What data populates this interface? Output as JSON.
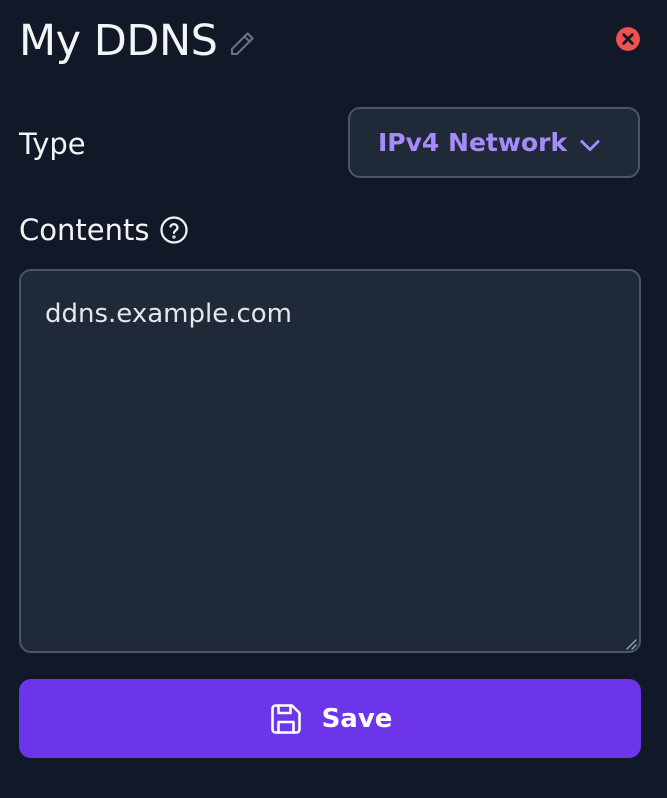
{
  "header": {
    "title": "My DDNS",
    "edit_icon": "pencil-icon",
    "close_icon": "close-circle-icon"
  },
  "form": {
    "type_label": "Type",
    "type_value": "IPv4 Network",
    "type_chevron_icon": "chevron-down-icon",
    "contents_label": "Contents",
    "help_icon": "question-circle-icon",
    "contents_value": "ddns.example.com"
  },
  "actions": {
    "save_label": "Save",
    "save_icon": "floppy-disk-icon"
  },
  "colors": {
    "background": "#111827",
    "field_background": "#1f2937",
    "border": "#4b5563",
    "accent_text": "#a78bfa",
    "save_button": "#6d35ea",
    "close_icon": "#f05252"
  }
}
